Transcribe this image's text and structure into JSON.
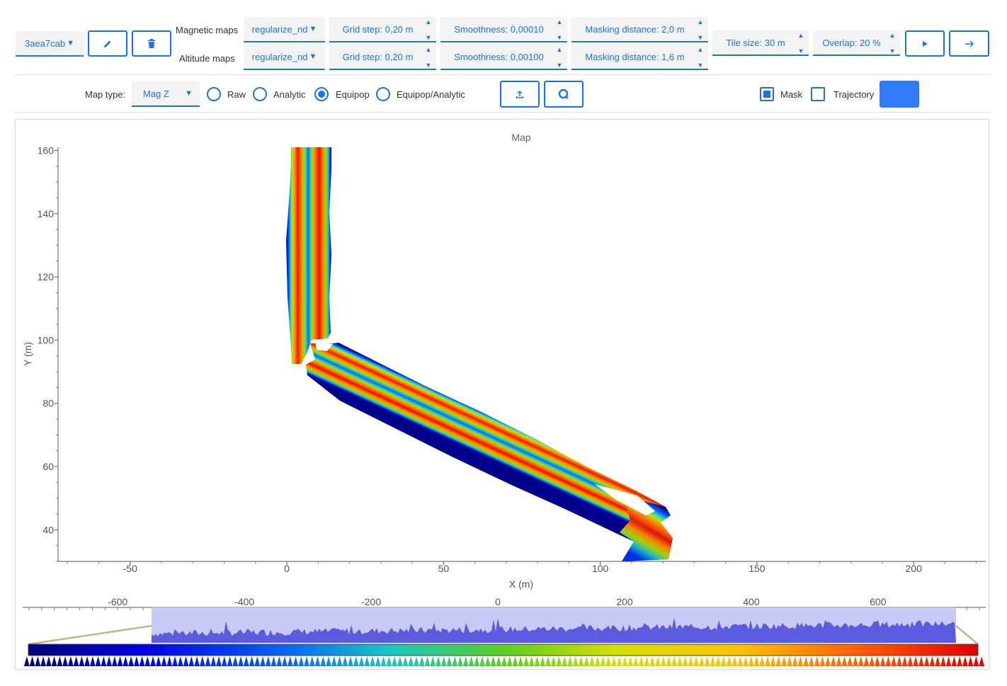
{
  "toolbar": {
    "dataset_select": "3aea7cab",
    "edit_icon": "pencil-icon",
    "delete_icon": "trash-icon",
    "magnetic_maps_label": "Magnetic maps",
    "altitude_maps_label": "Altitude maps",
    "magnetic": {
      "method": "regularize_nd",
      "grid_step": "Grid step: 0,20 m",
      "smoothness": "Smoothness: 0,00010",
      "masking": "Masking distance: 2,0 m"
    },
    "altitude": {
      "method": "regularize_nd",
      "grid_step": "Grid step: 0,20 m",
      "smoothness": "Smoothness: 0,00100",
      "masking": "Masking distance: 1,6 m"
    },
    "tile_size": "Tile size: 30 m",
    "overlap": "Overlap: 20 %",
    "play_icon": "play-icon",
    "next_icon": "arrow-right-icon"
  },
  "map_options": {
    "map_type_label": "Map type:",
    "map_type_value": "Mag Z",
    "radios": [
      "Raw",
      "Analytic",
      "Equipop",
      "Equipop/Analytic"
    ],
    "selected_radio": "Equipop",
    "export_icon": "upload-icon",
    "reset_icon": "zoom-reset-icon",
    "mask_label": "Mask",
    "mask_checked": true,
    "trajectory_label": "Trajectory",
    "trajectory_checked": false,
    "color_swatch": "#2f7cf6"
  },
  "chart_data": [
    {
      "type": "heatmap",
      "title": "Map",
      "xlabel": "X (m)",
      "ylabel": "Y (m)",
      "xlim": [
        -73,
        223
      ],
      "ylim": [
        30,
        161
      ],
      "x_ticks": [
        -50,
        0,
        50,
        100,
        150,
        200
      ],
      "y_ticks": [
        40,
        60,
        80,
        100,
        120,
        140,
        160
      ],
      "colormap": "jet"
    },
    {
      "type": "area",
      "xlim": [
        -750,
        770
      ],
      "x_ticks": [
        -600,
        -400,
        -200,
        0,
        200,
        400,
        600
      ],
      "selected_range": [
        -530,
        720
      ],
      "fill_color": "#5b5be0"
    }
  ]
}
